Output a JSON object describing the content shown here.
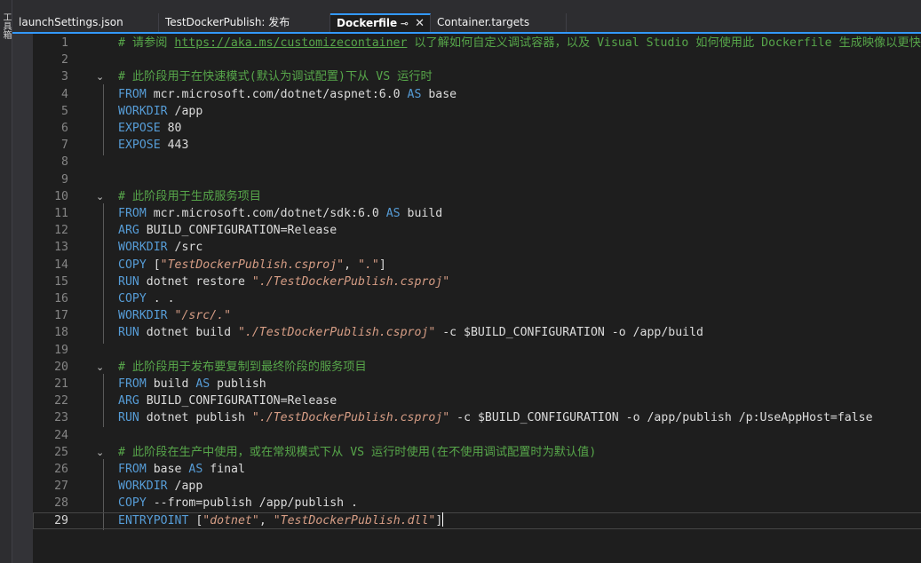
{
  "side_panel": {
    "label": "工具箱"
  },
  "tabs": [
    {
      "label": "launchSettings.json",
      "active": false
    },
    {
      "label": "TestDockerPublish: 发布",
      "active": false
    },
    {
      "label": "Dockerfile",
      "active": true,
      "pin_icon": "pin-icon",
      "close_icon": "close-icon"
    },
    {
      "label": "Container.targets",
      "active": false
    }
  ],
  "editor": {
    "current_line": 29,
    "lines": [
      {
        "n": "1",
        "tokens": [
          {
            "c": "cm",
            "t": "# 请参阅 "
          },
          {
            "c": "lk",
            "t": "https://aka.ms/customizecontainer"
          },
          {
            "c": "cm",
            "t": " 以了解如何自定义调试容器，以及 Visual Studio 如何使用此 Dockerfile 生成映像以更快地进行调试。"
          }
        ]
      },
      {
        "n": "2",
        "tokens": []
      },
      {
        "n": "3",
        "fold": true,
        "tokens": [
          {
            "c": "cm",
            "t": "# 此阶段用于在快速模式(默认为调试配置)下从 VS 运行时"
          }
        ]
      },
      {
        "n": "4",
        "tokens": [
          {
            "c": "kw",
            "t": "FROM"
          },
          {
            "c": "tx",
            "t": " mcr.microsoft.com/dotnet/aspnet:6.0 "
          },
          {
            "c": "kw",
            "t": "AS"
          },
          {
            "c": "tx",
            "t": " base"
          }
        ]
      },
      {
        "n": "5",
        "tokens": [
          {
            "c": "kw",
            "t": "WORKDIR"
          },
          {
            "c": "tx",
            "t": " /app"
          }
        ]
      },
      {
        "n": "6",
        "tokens": [
          {
            "c": "kw",
            "t": "EXPOSE"
          },
          {
            "c": "tx",
            "t": " 80"
          }
        ]
      },
      {
        "n": "7",
        "tokens": [
          {
            "c": "kw",
            "t": "EXPOSE"
          },
          {
            "c": "tx",
            "t": " 443"
          }
        ]
      },
      {
        "n": "8",
        "tokens": []
      },
      {
        "n": "9",
        "tokens": []
      },
      {
        "n": "10",
        "fold": true,
        "tokens": [
          {
            "c": "cm",
            "t": "# 此阶段用于生成服务项目"
          }
        ]
      },
      {
        "n": "11",
        "tokens": [
          {
            "c": "kw",
            "t": "FROM"
          },
          {
            "c": "tx",
            "t": " mcr.microsoft.com/dotnet/sdk:6.0 "
          },
          {
            "c": "kw",
            "t": "AS"
          },
          {
            "c": "tx",
            "t": " build"
          }
        ]
      },
      {
        "n": "12",
        "tokens": [
          {
            "c": "kw",
            "t": "ARG"
          },
          {
            "c": "tx",
            "t": " BUILD_CONFIGURATION=Release"
          }
        ]
      },
      {
        "n": "13",
        "tokens": [
          {
            "c": "kw",
            "t": "WORKDIR"
          },
          {
            "c": "tx",
            "t": " /src"
          }
        ]
      },
      {
        "n": "14",
        "tokens": [
          {
            "c": "kw",
            "t": "COPY"
          },
          {
            "c": "tx",
            "t": " ["
          },
          {
            "c": "st",
            "t": "\"TestDockerPublish.csproj\""
          },
          {
            "c": "tx",
            "t": ", "
          },
          {
            "c": "st",
            "t": "\".\""
          },
          {
            "c": "tx",
            "t": "]"
          }
        ]
      },
      {
        "n": "15",
        "tokens": [
          {
            "c": "kw",
            "t": "RUN"
          },
          {
            "c": "tx",
            "t": " dotnet restore "
          },
          {
            "c": "st",
            "t": "\"./TestDockerPublish.csproj\""
          }
        ]
      },
      {
        "n": "16",
        "tokens": [
          {
            "c": "kw",
            "t": "COPY"
          },
          {
            "c": "tx",
            "t": " . ."
          }
        ]
      },
      {
        "n": "17",
        "tokens": [
          {
            "c": "kw",
            "t": "WORKDIR"
          },
          {
            "c": "tx",
            "t": " "
          },
          {
            "c": "st",
            "t": "\"/src/.\""
          }
        ]
      },
      {
        "n": "18",
        "tokens": [
          {
            "c": "kw",
            "t": "RUN"
          },
          {
            "c": "tx",
            "t": " dotnet build "
          },
          {
            "c": "st",
            "t": "\"./TestDockerPublish.csproj\""
          },
          {
            "c": "tx",
            "t": " -c $BUILD_CONFIGURATION -o /app/build"
          }
        ]
      },
      {
        "n": "19",
        "tokens": []
      },
      {
        "n": "20",
        "fold": true,
        "tokens": [
          {
            "c": "cm",
            "t": "# 此阶段用于发布要复制到最终阶段的服务项目"
          }
        ]
      },
      {
        "n": "21",
        "tokens": [
          {
            "c": "kw",
            "t": "FROM"
          },
          {
            "c": "tx",
            "t": " build "
          },
          {
            "c": "kw",
            "t": "AS"
          },
          {
            "c": "tx",
            "t": " publish"
          }
        ]
      },
      {
        "n": "22",
        "tokens": [
          {
            "c": "kw",
            "t": "ARG"
          },
          {
            "c": "tx",
            "t": " BUILD_CONFIGURATION=Release"
          }
        ]
      },
      {
        "n": "23",
        "tokens": [
          {
            "c": "kw",
            "t": "RUN"
          },
          {
            "c": "tx",
            "t": " dotnet publish "
          },
          {
            "c": "st",
            "t": "\"./TestDockerPublish.csproj\""
          },
          {
            "c": "tx",
            "t": " -c $BUILD_CONFIGURATION -o /app/publish /p:UseAppHost=false"
          }
        ]
      },
      {
        "n": "24",
        "tokens": []
      },
      {
        "n": "25",
        "fold": true,
        "tokens": [
          {
            "c": "cm",
            "t": "# 此阶段在生产中使用，或在常规模式下从 VS 运行时使用(在不使用调试配置时为默认值)"
          }
        ]
      },
      {
        "n": "26",
        "tokens": [
          {
            "c": "kw",
            "t": "FROM"
          },
          {
            "c": "tx",
            "t": " base "
          },
          {
            "c": "kw",
            "t": "AS"
          },
          {
            "c": "tx",
            "t": " final"
          }
        ]
      },
      {
        "n": "27",
        "tokens": [
          {
            "c": "kw",
            "t": "WORKDIR"
          },
          {
            "c": "tx",
            "t": " /app"
          }
        ]
      },
      {
        "n": "28",
        "tokens": [
          {
            "c": "kw",
            "t": "COPY"
          },
          {
            "c": "tx",
            "t": " --from=publish /app/publish ."
          }
        ]
      },
      {
        "n": "29",
        "tokens": [
          {
            "c": "kw",
            "t": "ENTRYPOINT"
          },
          {
            "c": "tx",
            "t": " ["
          },
          {
            "c": "st",
            "t": "\"dotnet\""
          },
          {
            "c": "tx",
            "t": ", "
          },
          {
            "c": "st",
            "t": "\"TestDockerPublish.dll\""
          },
          {
            "c": "tx",
            "t": "]"
          }
        ]
      }
    ]
  }
}
